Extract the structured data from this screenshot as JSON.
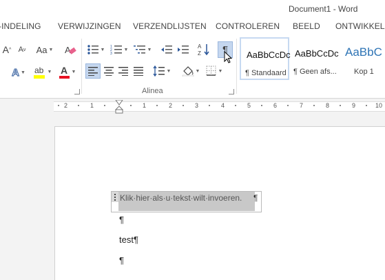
{
  "window": {
    "title": "Document1 - Word"
  },
  "tabs": [
    "-INDELING",
    "VERWIJZINGEN",
    "VERZENDLIJSTEN",
    "CONTROLEREN",
    "BEELD",
    "ONTWIKKELA"
  ],
  "ribbon": {
    "font_group": {
      "grow_label": "A",
      "shrink_label": "A",
      "case_label": "Aa",
      "text_effects_label": "A",
      "font_color_label": "A",
      "highlight_color": "#ffff00",
      "font_color": "#e81123"
    },
    "paragraph_group_label": "Alinea",
    "pilcrow_label": "¶",
    "styles": [
      {
        "preview": "AaBbCcDc",
        "name": "¶ Standaard"
      },
      {
        "preview": "AaBbCcDc",
        "name": "¶ Geen afs..."
      },
      {
        "preview": "AaBbC",
        "name": "Kop 1"
      }
    ]
  },
  "ruler": {
    "numbers": [
      "2",
      "1",
      "1",
      "2",
      "3",
      "4",
      "5",
      "6",
      "7",
      "8",
      "9",
      "10"
    ]
  },
  "document": {
    "content_control_placeholder": "Klik·hier·als·u·tekst·wilt·invoeren.",
    "pilcrow": "¶",
    "line2": "¶",
    "line3": "test¶",
    "line4": "¶"
  },
  "accent": "#2b579a"
}
